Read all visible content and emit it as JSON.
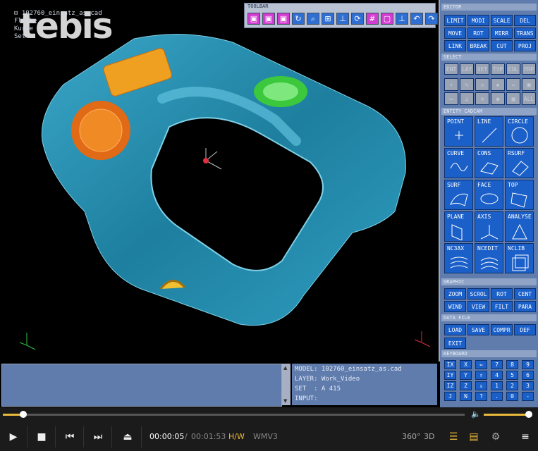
{
  "logo": "tebis",
  "tree": [
    "⊟ 102760_einsatz_as.cad",
    "  Fläche",
    "  Kurve",
    "  Set"
  ],
  "toolbar": {
    "title": "TOOLBAR"
  },
  "panel": {
    "editor": {
      "title": "EDITOR",
      "buttons": [
        "LIMIT",
        "MODI",
        "SCALE",
        "DEL",
        "MOVE",
        "ROT",
        "MIRR",
        "TRANS",
        "LINK",
        "BREAK",
        "CUT",
        "PROJ"
      ]
    },
    "select": {
      "title": "SELECT",
      "buttons": [
        "ENT",
        "LAY",
        "SET",
        "TYP",
        "COL",
        "FRP"
      ],
      "icon_row_last": "ALL"
    },
    "entity": {
      "title": "ENTITY  CADCAM",
      "buttons": [
        "POINT",
        "LINE",
        "CIRCLE",
        "CURVE",
        "CONS",
        "RSURF",
        "SURF",
        "FACE",
        "TOP",
        "PLANE",
        "AXIS",
        "ANALYSE",
        "NC3AX",
        "NCEDIT",
        "NCLIB"
      ]
    },
    "graphic": {
      "title": "GRAPHIC",
      "buttons": [
        "ZOOM",
        "SCROL",
        "ROT",
        "CENT",
        "WIND",
        "VIEW",
        "FILT",
        "PARA"
      ]
    },
    "data": {
      "title": "DATA    FILE",
      "buttons": [
        "LOAD",
        "SAVE",
        "COMPR",
        "DEF",
        "EXIT"
      ]
    },
    "keyboard": {
      "title": "KEYBOARD",
      "keys": [
        "IX",
        "X",
        "⇐",
        "7",
        "8",
        "9",
        "IY",
        "Y",
        "⇑",
        "4",
        "5",
        "6",
        "IZ",
        "Z",
        "⇓",
        "1",
        "2",
        "3",
        "J",
        "N",
        "?",
        ".",
        "0",
        "-"
      ]
    }
  },
  "info": {
    "model": "MODEL: 102760_einsatz_as.cad",
    "layer": "LAYER: Work_Video",
    "set": "SET  : A 415",
    "input": "INPUT:"
  },
  "player": {
    "progress": 0.044,
    "volume": 1.0,
    "current_time": "00:00:05",
    "separator": "/",
    "total_time": "00:01:53",
    "hw": "H/W",
    "format": "WMV3",
    "label_360": "360°",
    "label_3d": "3D",
    "colors": {
      "accent": "#e8b93a"
    }
  }
}
